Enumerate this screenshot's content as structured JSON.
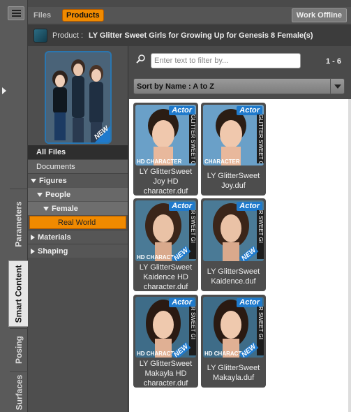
{
  "vertical_tabs": {
    "parameters": "Parameters",
    "smart_content": "Smart Content",
    "posing": "Posing",
    "surfaces": "Surfaces"
  },
  "top_tabs": {
    "files": "Files",
    "products": "Products",
    "work_offline": "Work Offline"
  },
  "product": {
    "prefix": "Product :",
    "name": "LY Glitter Sweet Girls for Growing Up for Genesis 8 Female(s)"
  },
  "categories": {
    "all_files": "All Files",
    "documents": "Documents",
    "figures": "Figures",
    "people": "People",
    "female": "Female",
    "real_world": "Real World",
    "materials": "Materials",
    "shaping": "Shaping"
  },
  "filter": {
    "placeholder": "Enter text to filter by...",
    "count": "1 - 6"
  },
  "sort": {
    "label": "Sort by Name : A to Z"
  },
  "cards": [
    {
      "label": "LY GlitterSweet Joy HD character.duf",
      "badge": "Actor",
      "side": "GLITTER SWEET GI",
      "hd": "HD CHARACTER",
      "new": ""
    },
    {
      "label": "LY GlitterSweet Joy.duf",
      "badge": "Actor",
      "side": "GLITTER SWEET GI",
      "hd": "CHARACTER",
      "new": ""
    },
    {
      "label": "LY GlitterSweet Kaidence HD character.duf",
      "badge": "Actor",
      "side": "R SWEET GI",
      "hd": "HD CHARACTER",
      "new": "NEW"
    },
    {
      "label": "LY GlitterSweet Kaidence.duf",
      "badge": "Actor",
      "side": "R SWEET GI",
      "hd": "",
      "new": "NEW"
    },
    {
      "label": "LY GlitterSweet Makayla HD character.duf",
      "badge": "Actor",
      "side": "R SWEET GI",
      "hd": "HD CHARACTER",
      "new": "NEW"
    },
    {
      "label": "LY GlitterSweet Makayla.duf",
      "badge": "Actor",
      "side": "R SWEET GI",
      "hd": "HD CHARACTER",
      "new": "NEW"
    }
  ],
  "thumbnail": {
    "new_badge": "NEW"
  },
  "colors": {
    "accent_orange": "#f08a00",
    "accent_blue": "#1f7acc",
    "panel_dark": "#4a4a4a"
  }
}
